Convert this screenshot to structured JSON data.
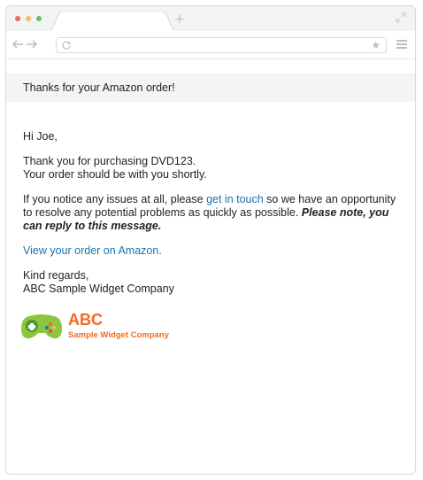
{
  "browser": {
    "new_tab_glyph": "+",
    "star_glyph": "★",
    "icons": [
      "back-arrow-icon",
      "forward-arrow-icon",
      "reload-icon",
      "bookmark-star-icon",
      "menu-icon",
      "expand-icon"
    ]
  },
  "email": {
    "subject": "Thanks for your Amazon order!",
    "greeting": "Hi Joe,",
    "purchase_line1": "Thank you for purchasing DVD123.",
    "purchase_line2": "Your order should be with you shortly.",
    "issues_prefix": "If you notice any issues at all, please ",
    "issues_link": "get in touch",
    "issues_suffix": " so we have an opportunity to resolve any potential problems as quickly as possible. ",
    "issues_note": "Please note, you can reply to this message.",
    "order_link": "View your order on Amazon.",
    "signoff": "Kind regards,",
    "signature": "ABC Sample Widget Company"
  },
  "logo": {
    "abbr": "ABC",
    "name": "Sample Widget Company",
    "icon": "gamepad-icon",
    "brand_color": "#f26a21"
  },
  "colors": {
    "link": "#1a73ad",
    "header_band": "#f2f4f6",
    "text": "#222222"
  }
}
